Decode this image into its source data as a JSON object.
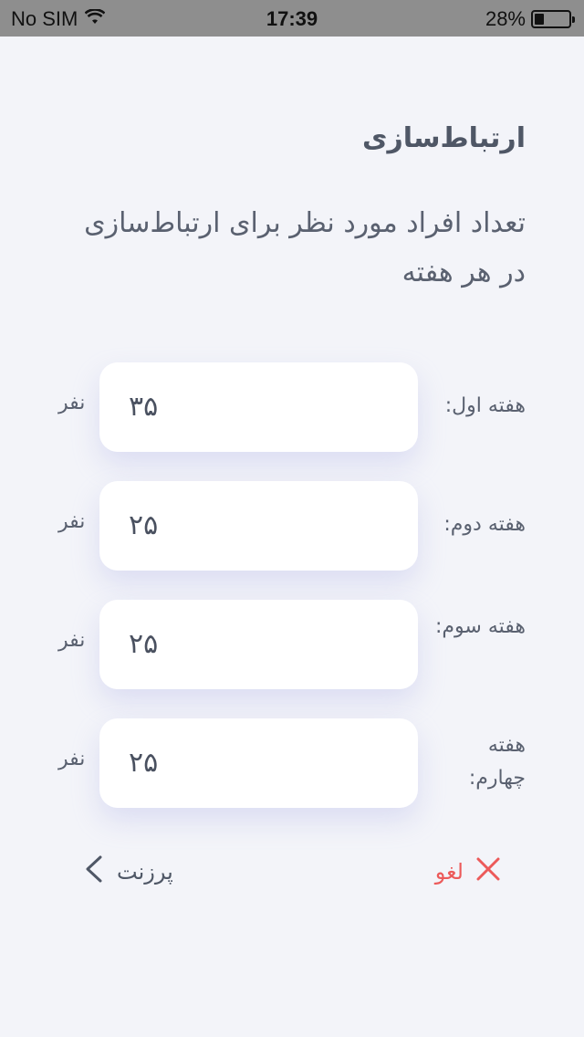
{
  "status_bar": {
    "carrier": "No SIM",
    "time": "17:39",
    "battery": "28%",
    "battery_level": 0.28
  },
  "header": {
    "title": "ارتباط‌سازی",
    "description": "تعداد افراد مورد نظر برای ارتباط‌سازی در هر هفته"
  },
  "weeks": [
    {
      "label": "هفته اول:",
      "value": "۳۵",
      "unit": "نفر"
    },
    {
      "label": "هفته دوم:",
      "value": "۲۵",
      "unit": "نفر"
    },
    {
      "label": "هفته سوم:",
      "value": "۲۵",
      "unit": "نفر"
    },
    {
      "label": "هفته چهارم:",
      "value": "۲۵",
      "unit": "نفر"
    }
  ],
  "footer": {
    "cancel_label": "لغو",
    "present_label": "پرزنت"
  },
  "colors": {
    "background": "#f3f4f9",
    "cancel": "#ec5a5a",
    "text": "#5a6170"
  }
}
